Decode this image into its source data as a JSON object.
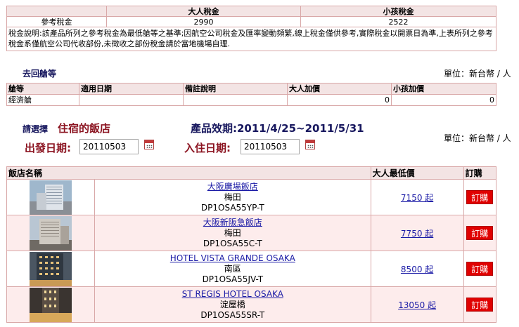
{
  "tax": {
    "headers": [
      "",
      "大人稅金",
      "小孩稅金"
    ],
    "row_label": "參考稅金",
    "adult": "2990",
    "child": "2522",
    "note": "稅金說明:該產品所列之參考稅金為最低艙等之基準;因航空公司稅金及匯率變動頻繁,線上稅金僅供參考,實際稅金以開票日為準,上表所列之參考稅金系僅航空公司代收部份,未徵收之部份稅金請於當地機場自理."
  },
  "cabin_section": {
    "title": "去回艙等",
    "unit": "單位：新台幣 / 人",
    "headers": [
      "艙等",
      "適用日期",
      "備註說明",
      "大人加價",
      "小孩加價"
    ],
    "rows": [
      {
        "class": "經濟艙",
        "date": "",
        "remark": "",
        "adult": "0",
        "child": "0"
      }
    ]
  },
  "hotel_pick": {
    "label": "請選擇",
    "title": "住宿的飯店",
    "validity": "產品效期:2011/4/25~2011/5/31",
    "unit": "單位：新台幣 / 人",
    "depart_label": "出發日期:",
    "depart_value": "20110503",
    "checkin_label": "入住日期:",
    "checkin_value": "20110503"
  },
  "hotel_table": {
    "headers": [
      "飯店名稱",
      "大人最低價",
      "訂購"
    ],
    "rows": [
      {
        "name": "大阪廣場飯店",
        "area": "梅田",
        "code": "DP1OSA55YP-T",
        "price": "7150 起",
        "buy": "訂購"
      },
      {
        "name": "大阪新阪急飯店",
        "area": "梅田",
        "code": "DP1OSA55C-T",
        "price": "7750 起",
        "buy": "訂購"
      },
      {
        "name": "HOTEL VISTA GRANDE OSAKA",
        "area": "南區",
        "code": "DP1OSA55JV-T",
        "price": "8500 起",
        "buy": "訂購"
      },
      {
        "name": "ST REGIS HOTEL OSAKA",
        "area": "淀屋橋",
        "code": "DP1OSA55SR-T",
        "price": "13050 起",
        "buy": "訂購"
      }
    ]
  },
  "colors": {
    "header_bg": "#f3e4e4",
    "border": "#d9a8a8",
    "accent_red": "#8b1320",
    "navy": "#17175e",
    "buy_button": "#e00000",
    "link": "#1a1aa6"
  }
}
